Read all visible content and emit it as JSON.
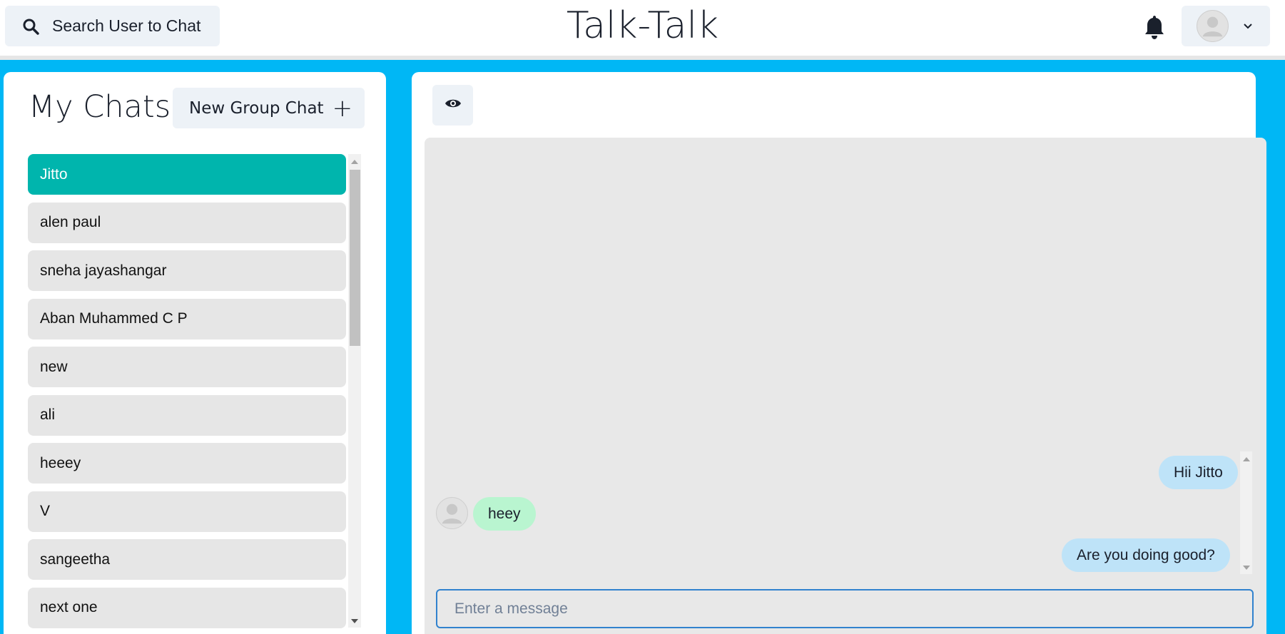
{
  "header": {
    "search_label": "Search User to Chat",
    "app_title": "Talk-Talk"
  },
  "left": {
    "title": "My Chats",
    "new_group_label": "New Group Chat",
    "new_group_plus": "+",
    "chats": [
      {
        "name": "Jitto",
        "active": true
      },
      {
        "name": "alen paul",
        "active": false
      },
      {
        "name": "sneha jayashangar",
        "active": false
      },
      {
        "name": "Aban Muhammed C P",
        "active": false
      },
      {
        "name": "new",
        "active": false
      },
      {
        "name": "ali",
        "active": false
      },
      {
        "name": "heeey",
        "active": false
      },
      {
        "name": "V",
        "active": false
      },
      {
        "name": "sangeetha",
        "active": false
      },
      {
        "name": "next one",
        "active": false
      }
    ]
  },
  "chat": {
    "messages": [
      {
        "text": "Hii Jitto",
        "direction": "sent"
      },
      {
        "text": "heey",
        "direction": "received"
      },
      {
        "text": "Are you doing good?",
        "direction": "sent"
      }
    ],
    "input_placeholder": "Enter a message"
  },
  "colors": {
    "background": "#00b7f5",
    "active_chat": "#00b5ad",
    "sent_bubble": "#bee3f8",
    "received_bubble": "#b9f5d0",
    "input_border": "#3182ce"
  },
  "icons": [
    "search-icon",
    "bell-icon",
    "avatar",
    "chevron-down-icon",
    "plus-icon",
    "eye-icon"
  ]
}
